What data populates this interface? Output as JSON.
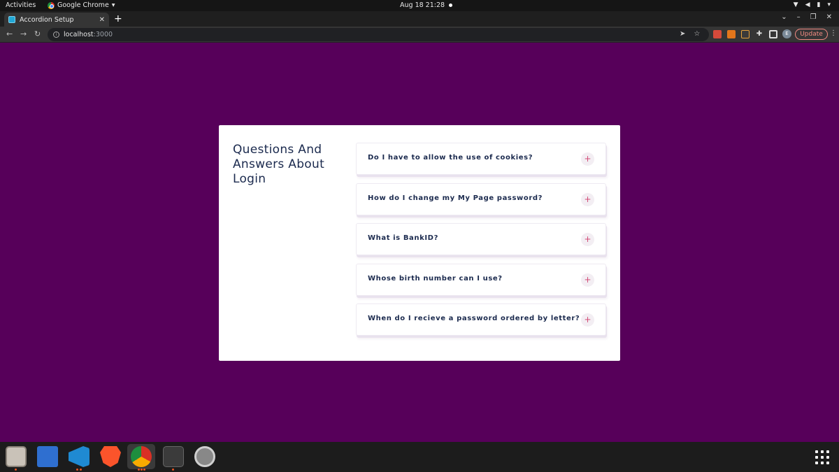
{
  "system": {
    "activities": "Activities",
    "app_name": "Google Chrome",
    "clock": "Aug 18  21:28"
  },
  "browser": {
    "tab_title": "Accordion Setup",
    "url_host": "localhost",
    "url_port": ":3000",
    "update_label": "Update",
    "avatar_letter": "E"
  },
  "page": {
    "heading": "Questions And Answers About Login",
    "faq": [
      {
        "question": "Do I have to allow the use of cookies?",
        "toggle": "+"
      },
      {
        "question": "How do I change my My Page password?",
        "toggle": "+"
      },
      {
        "question": "What is BankID?",
        "toggle": "+"
      },
      {
        "question": "Whose birth number can I use?",
        "toggle": "+"
      },
      {
        "question": "When do I recieve a password ordered by letter?",
        "toggle": "+"
      }
    ]
  },
  "dock": {
    "apps": [
      "files-icon",
      "text-editor-icon",
      "vscode-icon",
      "brave-icon",
      "chrome-icon",
      "terminal-icon",
      "settings-icon"
    ]
  },
  "colors": {
    "page_background": "#57005a",
    "heading_text": "#1b2a4e",
    "plus_accent": "#d24a75"
  }
}
